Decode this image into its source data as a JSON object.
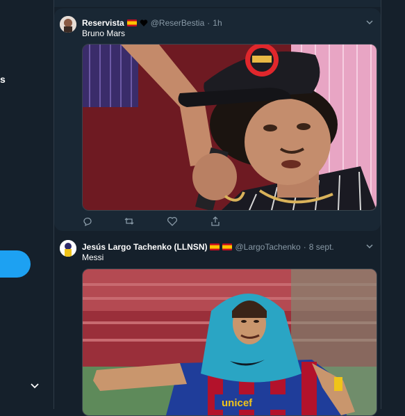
{
  "left": {
    "fragment": "s"
  },
  "tweets": [
    {
      "name": "Reservista",
      "handle": "@ReserBestia",
      "separator": "·",
      "time": "1h",
      "text": "Bruno Mars",
      "image_alt": "singer in black cap holding microphone"
    },
    {
      "name": "Jesús Largo Tachenko (LLNSN)",
      "handle": "@LargoTachenko",
      "separator": "·",
      "time": "8 sept.",
      "text": "Messi",
      "image_alt": "footballer with blue training bib over head"
    }
  ],
  "colors": {
    "background": "#15202b",
    "card": "#192734",
    "accent": "#1da1f2",
    "muted": "#8899a6"
  },
  "icons": [
    "reply-icon",
    "retweet-icon",
    "like-icon",
    "share-icon",
    "chevron-down-icon"
  ]
}
